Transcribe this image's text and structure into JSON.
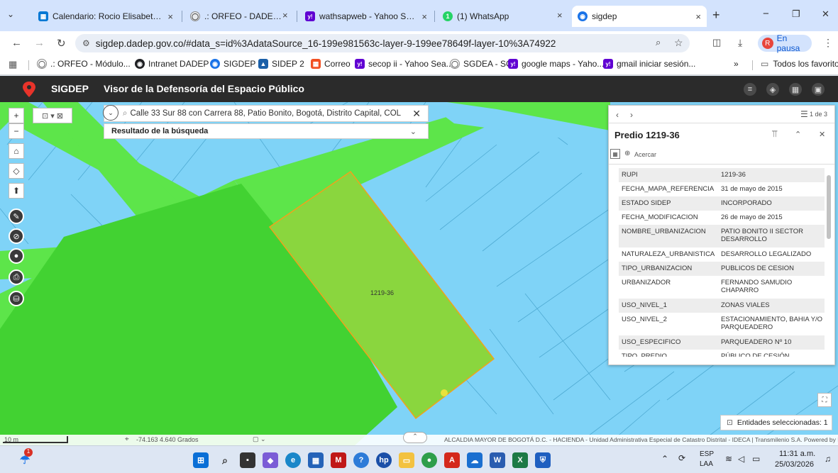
{
  "browser": {
    "tabs": [
      {
        "title": "Calendario: Rocio Elisabeth C",
        "fav_color": "#0078d4",
        "fav_glyph": "▦",
        "close": "×"
      },
      {
        "title": ".: ORFEO - DADEP ::.",
        "fav_color": "#e8eaed",
        "fav_glyph": "◯",
        "close": "×"
      },
      {
        "title": "wathsapweb - Yahoo Search",
        "fav_color": "#6001d2",
        "fav_glyph": "y!",
        "close": "×"
      },
      {
        "title": "(1) WhatsApp",
        "fav_color": "#25d366",
        "fav_glyph": "1",
        "close": "×"
      },
      {
        "title": "sigdep",
        "fav_color": "#1a73e8",
        "fav_glyph": "◉",
        "close": "×"
      }
    ],
    "new_tab": "+",
    "window_controls": {
      "minimize": "−",
      "restore": "❐",
      "close": "✕"
    },
    "url": "sigdep.dadep.gov.co/#data_s=id%3AdataSource_16-199e981563c-layer-9-199ee78649f-layer-10%3A74922",
    "profile_initial": "R",
    "profile_status": "En pausa",
    "bookmarks": [
      {
        "label": ".: ORFEO - Módulo...",
        "color": "#e8eaed",
        "glyph": "◯"
      },
      {
        "label": "Intranet DADEP",
        "color": "#202124",
        "glyph": "◉"
      },
      {
        "label": "SIGDEP",
        "color": "#1a73e8",
        "glyph": "◉"
      },
      {
        "label": "SIDEP 2",
        "color": "#1a5fa8",
        "glyph": "▲"
      },
      {
        "label": "Correo",
        "color": "#f25022",
        "glyph": "▦"
      },
      {
        "label": "secop ii - Yahoo Sea...",
        "color": "#6001d2",
        "glyph": "y!"
      },
      {
        "label": "SGDEA - SC",
        "color": "#e8eaed",
        "glyph": "◯"
      },
      {
        "label": "google maps - Yaho...",
        "color": "#6001d2",
        "glyph": "y!"
      },
      {
        "label": "gmail iniciar sesión...",
        "color": "#6001d2",
        "glyph": "y!"
      }
    ],
    "bookmarks_overflow": "»",
    "all_bookmarks": "Todos los favoritos"
  },
  "app": {
    "name": "SIGDEP",
    "subtitle": "Visor de la Defensoría del Espacio Público",
    "accent": "#e8332a"
  },
  "search": {
    "query": "Calle 33 Sur 88 con Carrera 88, Patio Bonito, Bogotá, Distrito Capital, COL",
    "results_label": "Resultado de la búsqueda"
  },
  "map": {
    "parcel_label": "1219-36",
    "scale": "10 m",
    "coordinates": "-74.163 4.640 Grados",
    "attribution": "ALCALDIA MAYOR DE BOGOTÁ D.C. - HACIENDA - Unidad Administrativa Especial de Catastro Distrital - IDECA | Transmilenio S.A.   Powered by Esri",
    "selected_entities": "Entidades seleccionadas: 1",
    "colors": {
      "water": "#7fd3f7",
      "street": "#5de54a",
      "parcel": "#8ad63e",
      "parcel_border": "#f0a21c"
    }
  },
  "popup": {
    "pager": "1 de 3",
    "title": "Predio 1219-36",
    "zoom_to": "Acercar",
    "fields": [
      {
        "key": "RUPI",
        "value": "1219-36"
      },
      {
        "key": "FECHA_MAPA_REFERENCIA",
        "value": "31 de mayo de 2015"
      },
      {
        "key": "ESTADO SIDEP",
        "value": "INCORPORADO"
      },
      {
        "key": "FECHA_MODIFICACION",
        "value": "26 de mayo de 2015"
      },
      {
        "key": "NOMBRE_URBANIZACION",
        "value": "PATIO BONITO II SECTOR DESARROLLO"
      },
      {
        "key": "NATURALEZA_URBANISTICA",
        "value": "DESARROLLO LEGALIZADO"
      },
      {
        "key": "TIPO_URBANIZACION",
        "value": "PUBLICOS DE CESION"
      },
      {
        "key": "URBANIZADOR",
        "value": "FERNANDO SAMUDIO CHAPARRO"
      },
      {
        "key": "USO_NIVEL_1",
        "value": "ZONAS VIALES"
      },
      {
        "key": "USO_NIVEL_2",
        "value": "ESTACIONAMIENTO, BAHIA Y/O PARQUEADERO"
      },
      {
        "key": "USO_ESPECIFICO",
        "value": "PARQUEADERO Nº 10"
      },
      {
        "key": "TIPO_PREDIO",
        "value": "PÚBLICO DE CESIÓN"
      }
    ]
  },
  "taskbar": {
    "weather_badge": "1",
    "language": "ESP",
    "layout": "LAA",
    "time": "11:31 a.m.",
    "date": "25/03/2026"
  }
}
